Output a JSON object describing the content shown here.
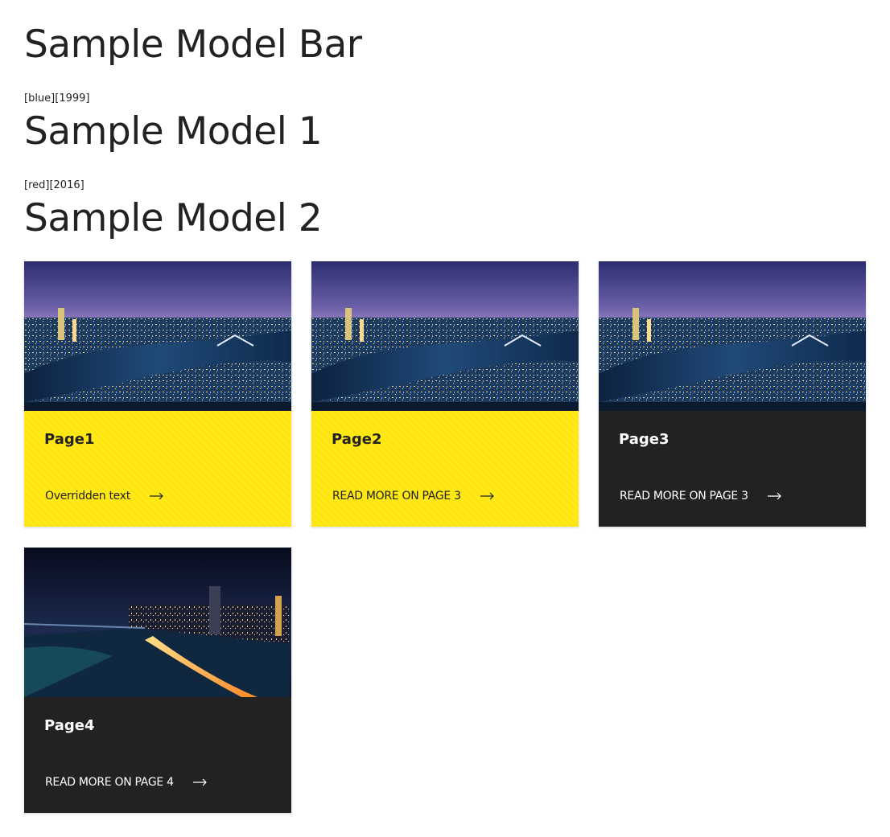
{
  "titles": {
    "bar": "Sample Model Bar",
    "model1": "Sample Model 1",
    "model2": "Sample Model 2"
  },
  "meta": {
    "model1": "[blue][1999]",
    "model2": "[red][2016]"
  },
  "cards": [
    {
      "title": "Page1",
      "cta": "Overridden text",
      "theme": "yellow",
      "image": "aerial-city-night-river-bridge"
    },
    {
      "title": "Page2",
      "cta": "READ MORE ON PAGE 3",
      "theme": "yellow",
      "image": "aerial-city-night-river-bridge"
    },
    {
      "title": "Page3",
      "cta": "READ MORE ON PAGE 3",
      "theme": "dark",
      "image": "aerial-city-night-river-bridge"
    },
    {
      "title": "Page4",
      "cta": "READ MORE ON PAGE 4",
      "theme": "dark",
      "image": "skyline-night-highway-river"
    }
  ],
  "colors": {
    "yellow": "#ffea16",
    "dark": "#222222",
    "text": "#222222"
  },
  "icons": {
    "cta": "arrow-right-icon"
  }
}
